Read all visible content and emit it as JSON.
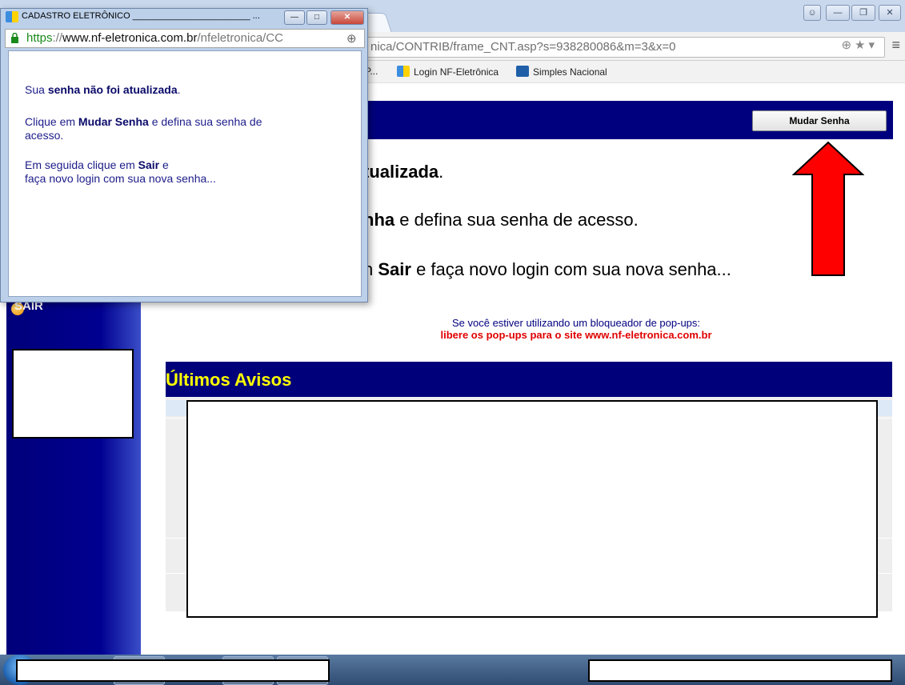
{
  "browser": {
    "address_url_visible": "nica/CONTRIB/frame_CNT.asp?s=938280086&m=3&x=0",
    "bookmarks": [
      {
        "label": "P...",
        "icon": "page-icon"
      },
      {
        "label": "Login NF-Eletrônica",
        "icon": "nf-eletronica-favicon"
      },
      {
        "label": "Simples Nacional",
        "icon": "simples-nacional-favicon"
      }
    ],
    "window_controls": [
      "user-icon",
      "minimize-icon",
      "maximize-icon",
      "close-icon"
    ]
  },
  "page": {
    "mudar_senha_label": "Mudar Senha",
    "msg1_plain": "tualizada",
    "msg1_end": ".",
    "msg2_bold": "nha",
    "msg2_rest": " e defina sua senha de acesso.",
    "msg3_prefix": "n ",
    "msg3_bold": "Sair",
    "msg3_rest": " e faça novo login com sua nova senha...",
    "sidebar_sair_label": "SAIR",
    "popup_note_line1": "Se você estiver utilizando um bloqueador de pop-ups:",
    "popup_note_line2": "libere os pop-ups para o site www.nf-eletronica.com.br",
    "avisos_title": "Últimos Avisos",
    "colors": {
      "header_blue": "#00007f",
      "avisos_title_yellow": "#ffff00",
      "warning_red": "#e00000",
      "arrow_red": "#ff0000"
    }
  },
  "popup": {
    "title": "CADASTRO ELETRÔNICO ________________________ ...",
    "url_scheme": "https",
    "url_sep": "://",
    "url_host": "www.nf-eletronica.com.br",
    "url_path": "/nfeletronica/CC",
    "line1_a": "Sua ",
    "line1_b": "senha não foi atualizada",
    "line1_c": ".",
    "line2_a": "Clique em ",
    "line2_b": "Mudar Senha",
    "line2_c": " e defina sua senha de",
    "line2_d": "acesso.",
    "line3_a": "Em seguida clique em ",
    "line3_b": "Sair",
    "line3_c": " e",
    "line3_d": "faça novo login com sua nova senha..."
  }
}
